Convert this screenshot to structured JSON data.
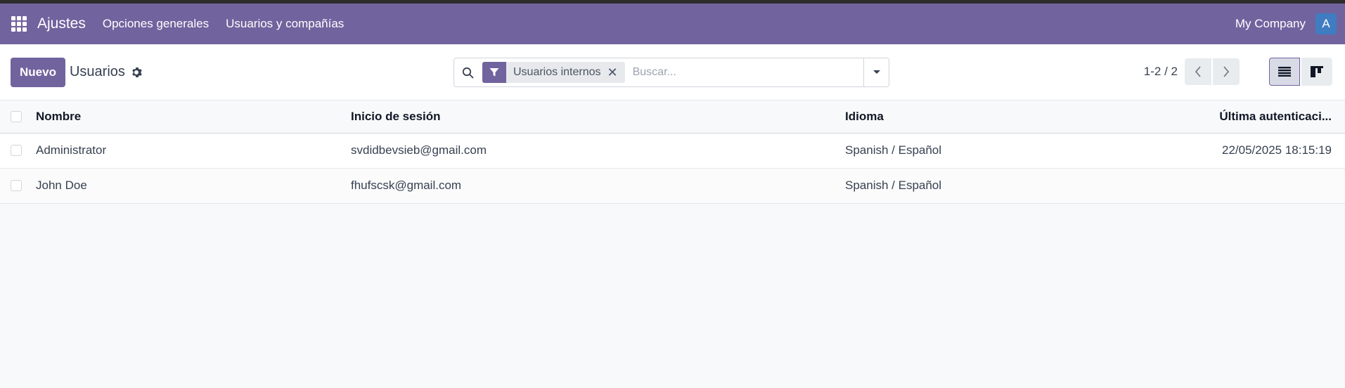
{
  "navbar": {
    "app_title": "Ajustes",
    "links": [
      "Opciones generales",
      "Usuarios y compañías"
    ],
    "company": "My Company",
    "avatar_letter": "A",
    "color": "#71639e"
  },
  "control_panel": {
    "new_button": "Nuevo",
    "title": "Usuarios",
    "search": {
      "facet": "Usuarios internos",
      "placeholder": "Buscar..."
    },
    "pager": "1-2 / 2"
  },
  "table": {
    "columns": [
      "Nombre",
      "Inicio de sesión",
      "Idioma",
      "Última autenticaci..."
    ],
    "rows": [
      {
        "name": "Administrator",
        "login": "svdidbevsieb@gmail.com",
        "lang": "Spanish / Español",
        "last": "22/05/2025 18:15:19"
      },
      {
        "name": "John Doe",
        "login": "fhufscsk@gmail.com",
        "lang": "Spanish / Español",
        "last": ""
      }
    ]
  }
}
